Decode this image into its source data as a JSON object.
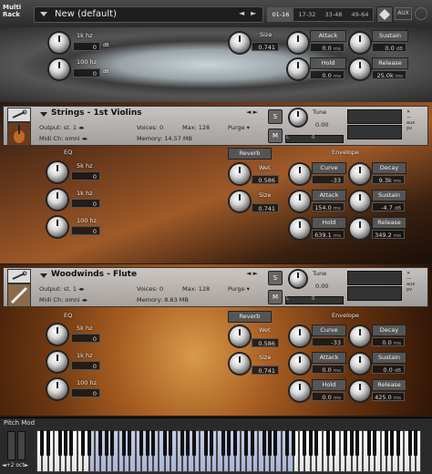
{
  "header": {
    "rack_label_1": "Multi",
    "rack_label_2": "Rack",
    "title": "New (default)",
    "prev": "◄",
    "next": "►",
    "tabs": [
      "01-16",
      "17-32",
      "33-48",
      "49-64"
    ],
    "aux": "AUX"
  },
  "top_partial": {
    "eq_rows": [
      {
        "label": "1k hz",
        "value": "0"
      },
      {
        "label": "100 hz",
        "value": "0"
      }
    ],
    "db": "dB",
    "size": {
      "label": "Size",
      "value": "0.741"
    },
    "attack": {
      "label": "Attack",
      "value": "0.0",
      "unit": "ms"
    },
    "hold": {
      "label": "Hold",
      "value": "0.0",
      "unit": "ms"
    },
    "sustain": {
      "label": "Sustain",
      "value": "0.0",
      "unit": "dB"
    },
    "release": {
      "label": "Release",
      "value": "25.0k",
      "unit": "ms"
    }
  },
  "instruments": [
    {
      "name": "Strings - 1st Violins",
      "output_label": "Output:",
      "output_value": "st. 1",
      "voices_label": "Voices:",
      "voices_value": "0",
      "max_label": "Max:",
      "max_value": "128",
      "purge": "Purge",
      "midi_label": "Midi Ch:",
      "midi_value": "omni",
      "memory_label": "Memory:",
      "memory_value": "14.57 MB",
      "tune_label": "Tune",
      "tune_value": "0.00",
      "pan_label": "L",
      "pan_value": "0",
      "s_btn": "S",
      "m_btn": "M",
      "eq_title": "EQ",
      "reverb": "Reverb",
      "envelope": "Envelope",
      "eq_rows": [
        {
          "label": "5k hz",
          "value": "0"
        },
        {
          "label": "1k hz",
          "value": "0"
        },
        {
          "label": "100 hz",
          "value": "0"
        }
      ],
      "wet": {
        "label": "Wet",
        "value": "0.586"
      },
      "size": {
        "label": "Size",
        "value": "0.741"
      },
      "curve": {
        "label": "Curve",
        "value": "-33"
      },
      "attack": {
        "label": "Attack",
        "value": "154.0",
        "unit": "ms"
      },
      "hold": {
        "label": "Hold",
        "value": "639.1",
        "unit": "ms"
      },
      "decay": {
        "label": "Decay",
        "value": "9.3k",
        "unit": "ms"
      },
      "sustain": {
        "label": "Sustain",
        "value": "-4.7",
        "unit": "dB"
      },
      "release": {
        "label": "Release",
        "value": "349.2",
        "unit": "ms"
      }
    },
    {
      "name": "Woodwinds - Flute",
      "output_label": "Output:",
      "output_value": "st. 1",
      "voices_label": "Voices:",
      "voices_value": "0",
      "max_label": "Max:",
      "max_value": "128",
      "purge": "Purge",
      "midi_label": "Midi Ch:",
      "midi_value": "omni",
      "memory_label": "Memory:",
      "memory_value": "8.83 MB",
      "tune_label": "Tune",
      "tune_value": "0.00",
      "pan_label": "L",
      "pan_value": "0",
      "s_btn": "S",
      "m_btn": "M",
      "eq_title": "EQ",
      "reverb": "Reverb",
      "envelope": "Envelope",
      "eq_rows": [
        {
          "label": "5k hz",
          "value": "0"
        },
        {
          "label": "1k hz",
          "value": "0"
        },
        {
          "label": "100 hz",
          "value": "0"
        }
      ],
      "wet": {
        "label": "Wet",
        "value": "0.586"
      },
      "size": {
        "label": "Size",
        "value": "0.741"
      },
      "curve": {
        "label": "Curve",
        "value": "-33"
      },
      "attack": {
        "label": "Attack",
        "value": "0.0",
        "unit": "ms"
      },
      "hold": {
        "label": "Hold",
        "value": "0.0",
        "unit": "ms"
      },
      "decay": {
        "label": "Decay",
        "value": "0.0",
        "unit": "ms"
      },
      "sustain": {
        "label": "Sustain",
        "value": "0.0",
        "unit": "dB"
      },
      "release": {
        "label": "Release",
        "value": "425.0",
        "unit": "ms"
      }
    }
  ],
  "keyboard": {
    "pitch_mod": "Pitch Mod",
    "octave": "◄+2 oct►"
  },
  "colors": {
    "header_bg": "#3a3a3a",
    "panel_head": "#b8b8b8",
    "key_highlight": "#aab4d8",
    "violin_bg": "#6b3a1c",
    "flute_bg": "#8a4a18",
    "drum_bg": "#6c6c6c"
  }
}
